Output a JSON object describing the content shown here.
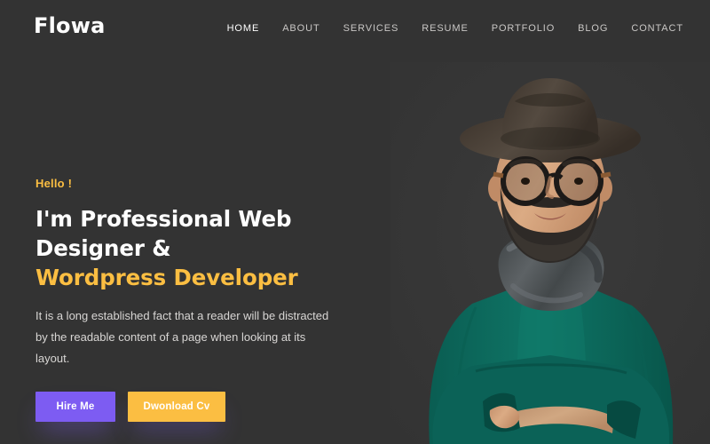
{
  "site": {
    "background_color": "#333333",
    "accent_color": "#fbbe42",
    "purple_color": "#7d5cf2"
  },
  "header": {
    "logo": "Flowa",
    "nav": [
      {
        "label": "HOME",
        "active": true
      },
      {
        "label": "ABOUT",
        "active": false
      },
      {
        "label": "SERVICES",
        "active": false
      },
      {
        "label": "RESUME",
        "active": false
      },
      {
        "label": "PORTFOLIO",
        "active": false
      },
      {
        "label": "BLOG",
        "active": false
      },
      {
        "label": "CONTACT",
        "active": false
      }
    ]
  },
  "hero": {
    "greeting": "Hello !",
    "headline_line1": "I'm Professional Web Designer &",
    "headline_line2": "Wordpress Developer",
    "paragraph": "It is a long established fact that a reader will be distracted by the readable content of a page when looking at its layout.",
    "primary_button": "Hire Me",
    "secondary_button": "Dwonload Cv"
  },
  "portrait": {
    "alt": "bearded man wearing fedora hat, glasses, gray scarf and teal sweater with arms crossed",
    "hat_color": "#4a4038",
    "sweater_color": "#0d6b5e",
    "scarf_color": "#4e5254",
    "skin_color": "#d8a882"
  }
}
